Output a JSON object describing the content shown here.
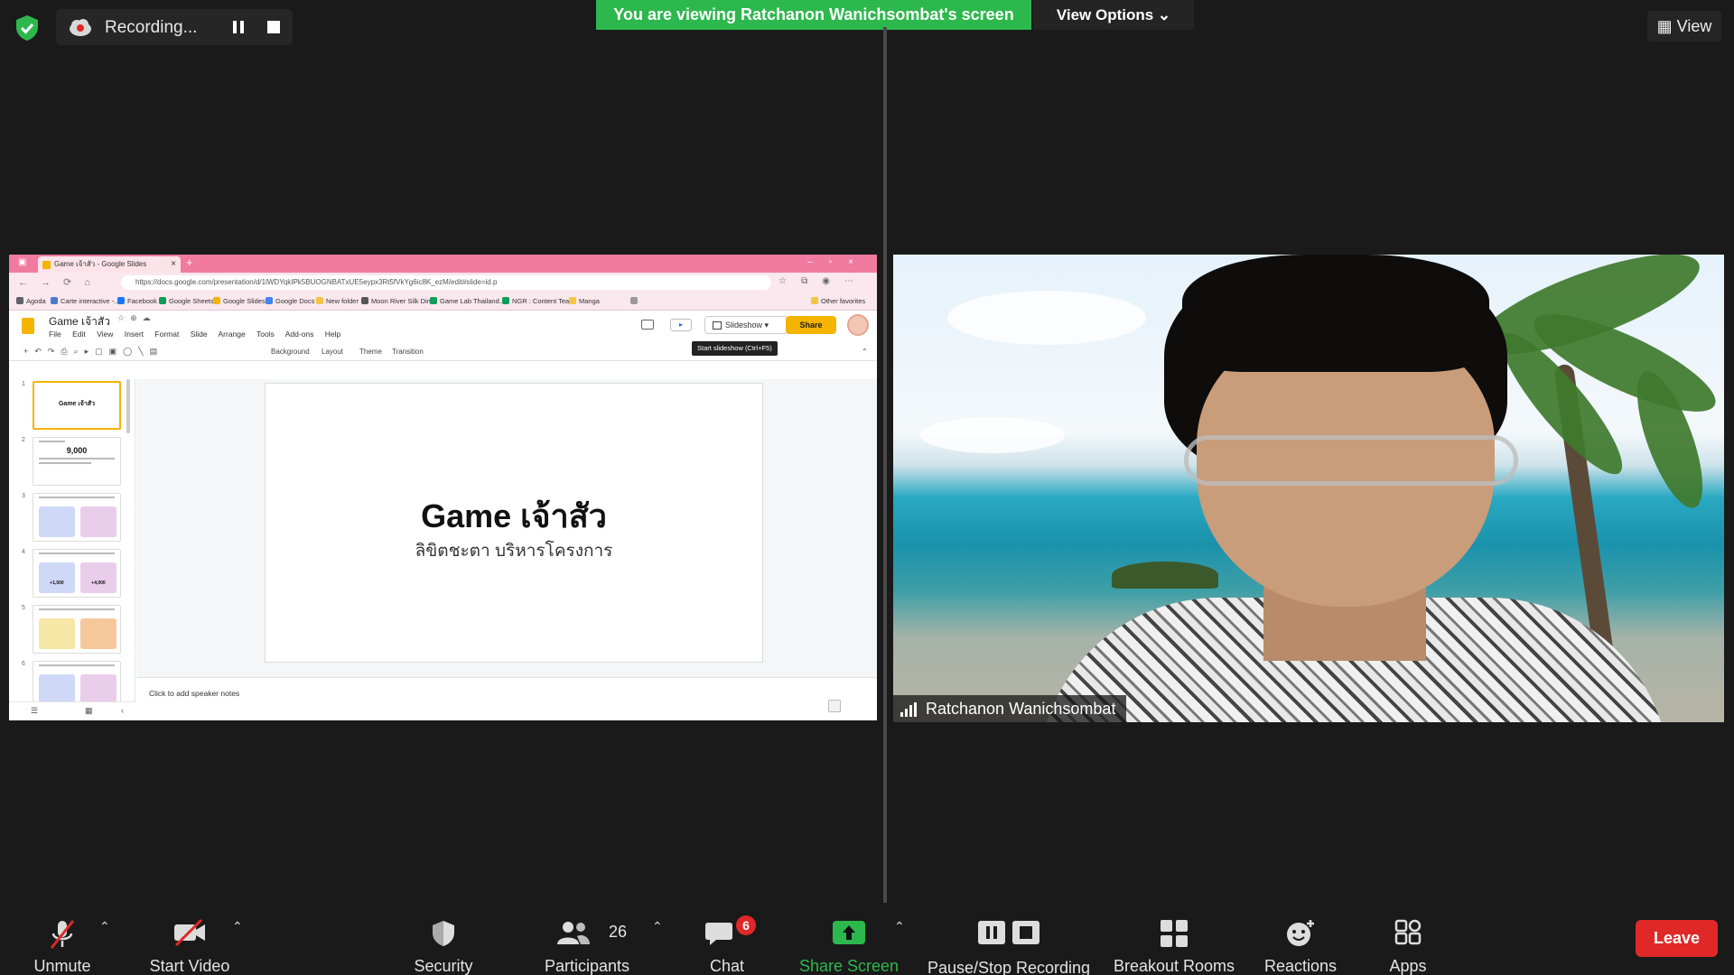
{
  "recording": {
    "label": "Recording..."
  },
  "banner": {
    "viewing": "You are viewing Ratchanon Wanichsombat's screen",
    "view_options": "View Options"
  },
  "top_right": {
    "view": "View"
  },
  "browser": {
    "tab_title": "Game เจ้าสัว - Google Slides",
    "url": "https://docs.google.com/presentation/d/1lWDYqkIPk5BUOGNBATxUE5eypx3Rt5fVkYg6ic8K_ezM/edit#slide=id.p",
    "bookmarks": [
      "Agoda",
      "Carte interactive -...",
      "Facebook",
      "Google Sheets",
      "Google Slides",
      "Google Docs",
      "New folder",
      "Moon River Silk Din...",
      "Game Lab Thailand...",
      "NGR : Content Tea...",
      "Manga",
      "Other favorites"
    ]
  },
  "slides_app": {
    "doc_title": "Game เจ้าสัว",
    "menu": [
      "File",
      "Edit",
      "View",
      "Insert",
      "Format",
      "Slide",
      "Arrange",
      "Tools",
      "Add-ons",
      "Help"
    ],
    "slideshow_label": "Slideshow",
    "share_label": "Share",
    "tooltip": "Start slideshow (Ctrl+F5)",
    "toolbar_text": [
      "Background",
      "Layout",
      "Theme",
      "Transition"
    ],
    "slide_title": "Game เจ้าสัว",
    "slide_subtitle": "ลิขิตชะตา บริหารโครงการ",
    "notes_placeholder": "Click to add speaker notes",
    "thumbs": [
      {
        "num": "1",
        "title": "Game เจ้าสัว"
      },
      {
        "num": "2",
        "value": "9,000"
      },
      {
        "num": "3"
      },
      {
        "num": "4",
        "a": "+1,500",
        "b": "+4,000"
      },
      {
        "num": "5"
      },
      {
        "num": "6"
      }
    ]
  },
  "video": {
    "participant_name": "Ratchanon Wanichsombat"
  },
  "toolbar": {
    "unmute": "Unmute",
    "start_video": "Start Video",
    "security": "Security",
    "participants": "Participants",
    "participants_count": "26",
    "chat": "Chat",
    "chat_badge": "6",
    "share_screen": "Share Screen",
    "pause_stop": "Pause/Stop Recording",
    "breakout": "Breakout Rooms",
    "reactions": "Reactions",
    "apps": "Apps",
    "leave": "Leave"
  },
  "colors": {
    "green": "#2db84d",
    "leave_red": "#e02828",
    "slides_yellow": "#f4b400",
    "browser_pink": "#f07aa0"
  }
}
